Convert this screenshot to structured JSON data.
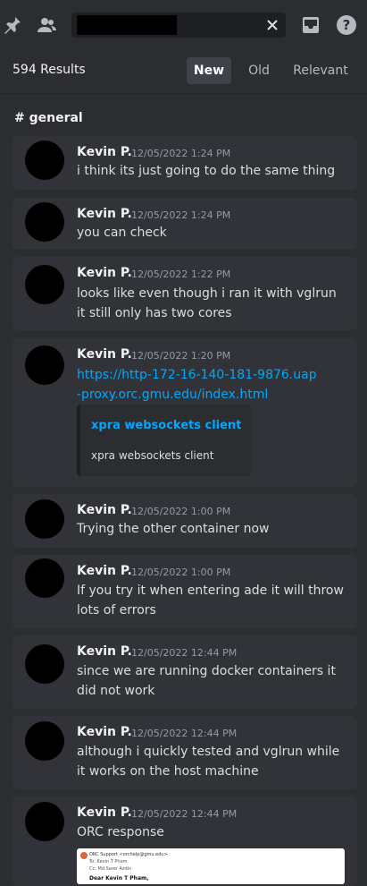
{
  "search": {
    "value": "",
    "placeholder": ""
  },
  "results": {
    "count_label": "594 Results"
  },
  "sort": {
    "new": "New",
    "old": "Old",
    "relevant": "Relevant"
  },
  "channel": {
    "label": "# general"
  },
  "messages": [
    {
      "author": "Kevin P.",
      "time": "12/05/2022 1:24 PM",
      "text": "i think its just going to do the same thing"
    },
    {
      "author": "Kevin P.",
      "time": "12/05/2022 1:24 PM",
      "text": "you can check"
    },
    {
      "author": "Kevin P.",
      "time": "12/05/2022 1:22 PM",
      "text": "looks like even though i ran it with vglrun it still only has two cores"
    },
    {
      "author": "Kevin P.",
      "time": "12/05/2022 1:20 PM",
      "link": "https://http-172-16-140-181-9876.uap-proxy.orc.gmu.edu/index.html",
      "embed": {
        "title": "xpra websockets client",
        "description": "xpra websockets client"
      }
    },
    {
      "author": "Kevin P.",
      "time": "12/05/2022 1:00 PM",
      "text": "Trying the other container now"
    },
    {
      "author": "Kevin P.",
      "time": "12/05/2022 1:00 PM",
      "text": "If you try it when entering ade it will throw lots of errors"
    },
    {
      "author": "Kevin P.",
      "time": "12/05/2022 12:44 PM",
      "text": "since we are running docker containers it did not work"
    },
    {
      "author": "Kevin P.",
      "time": "12/05/2022 12:44 PM",
      "text": "although i quickly tested and vglrun while it works on the host machine"
    },
    {
      "author": "Kevin P.",
      "time": "12/05/2022 12:44 PM",
      "text": "ORC response",
      "attachment": {
        "from": "ORC Support <orchelp@gmu.edu>",
        "to": "To: Kevin T Pham",
        "cc": "Cc: Md Sarer Azdin",
        "greeting": "Dear Kevin T Pham,"
      }
    }
  ]
}
